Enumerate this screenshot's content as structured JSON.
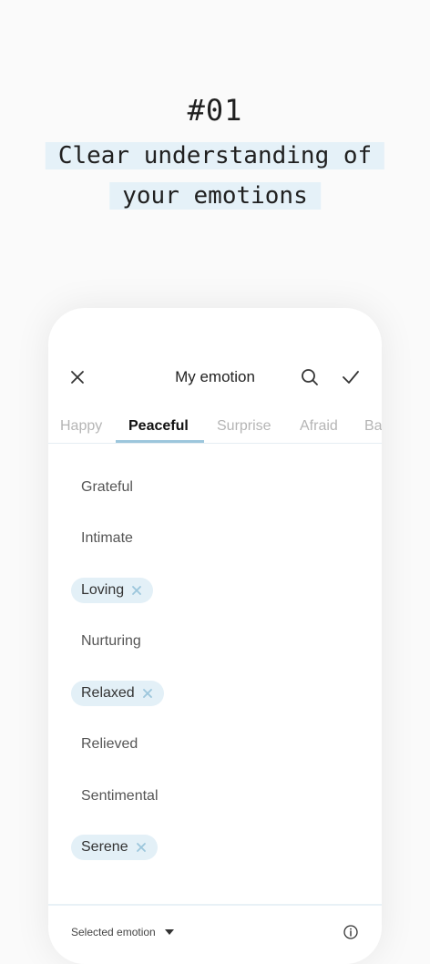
{
  "hero": {
    "number": "#01",
    "line1": "Clear understanding of",
    "line2": "your emotions"
  },
  "topbar": {
    "title": "My emotion",
    "icons": [
      "close-icon",
      "search-icon",
      "check-icon"
    ]
  },
  "tabs": [
    {
      "label": "Happy",
      "active": false
    },
    {
      "label": "Peaceful",
      "active": true
    },
    {
      "label": "Surprise",
      "active": false
    },
    {
      "label": "Afraid",
      "active": false
    },
    {
      "label": "Ba",
      "active": false
    }
  ],
  "emotions": [
    {
      "label": "Grateful",
      "selected": false
    },
    {
      "label": "Intimate",
      "selected": false
    },
    {
      "label": "Loving",
      "selected": true
    },
    {
      "label": "Nurturing",
      "selected": false
    },
    {
      "label": "Relaxed",
      "selected": true
    },
    {
      "label": "Relieved",
      "selected": false
    },
    {
      "label": "Sentimental",
      "selected": false
    },
    {
      "label": "Serene",
      "selected": true
    }
  ],
  "footer": {
    "label": "Selected emotion",
    "icons": [
      "caret-down-icon",
      "info-icon"
    ]
  },
  "colors": {
    "accent": "#9cc6dc",
    "chip_bg": "#e3f0f7",
    "highlight": "#e5f1f8"
  }
}
